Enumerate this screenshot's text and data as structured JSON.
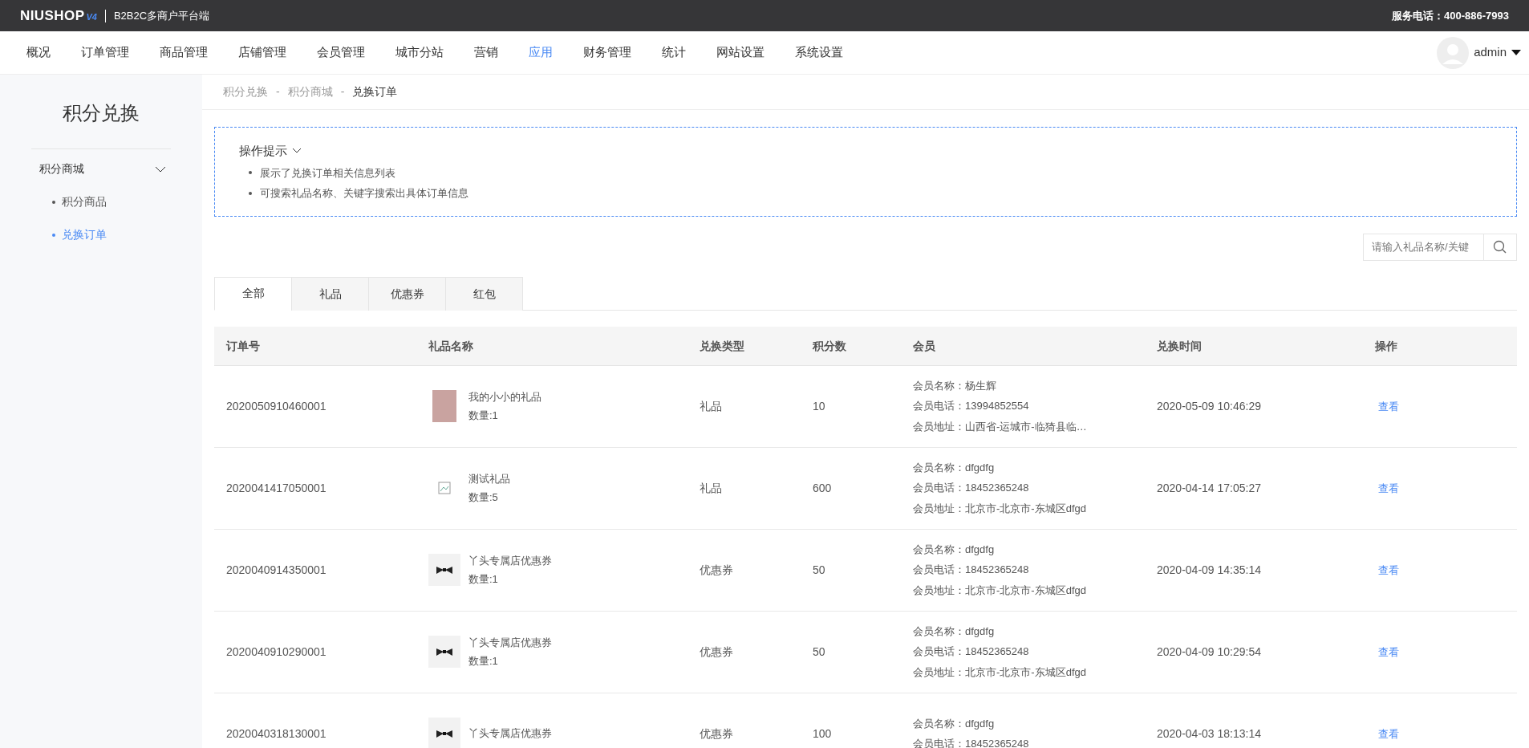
{
  "topbar": {
    "logo": "NIUSHOP",
    "logo_badge": "V4",
    "platform": "B2B2C多商户平台端",
    "service_phone": "服务电话：400-886-7993"
  },
  "nav": [
    {
      "label": "概况",
      "selected": false
    },
    {
      "label": "订单管理",
      "selected": false
    },
    {
      "label": "商品管理",
      "selected": false
    },
    {
      "label": "店铺管理",
      "selected": false
    },
    {
      "label": "会员管理",
      "selected": false
    },
    {
      "label": "城市分站",
      "selected": false
    },
    {
      "label": "营销",
      "selected": false
    },
    {
      "label": "应用",
      "selected": true
    },
    {
      "label": "财务管理",
      "selected": false
    },
    {
      "label": "统计",
      "selected": false
    },
    {
      "label": "网站设置",
      "selected": false
    },
    {
      "label": "系统设置",
      "selected": false
    }
  ],
  "user": {
    "name": "admin"
  },
  "sidebar": {
    "title": "积分兑换",
    "group": {
      "label": "积分商城",
      "expanded": true,
      "items": [
        {
          "label": "积分商品",
          "selected": false
        },
        {
          "label": "兑换订单",
          "selected": true
        }
      ]
    }
  },
  "breadcrumb": [
    "积分兑换",
    "积分商城",
    "兑换订单"
  ],
  "breadcrumb_separator": "-",
  "tips": {
    "title": "操作提示",
    "items": [
      "展示了兑换订单相关信息列表",
      "可搜索礼品名称、关键字搜索出具体订单信息"
    ]
  },
  "search": {
    "placeholder": "请输入礼品名称/关键"
  },
  "tabs": [
    {
      "label": "全部",
      "selected": true
    },
    {
      "label": "礼品",
      "selected": false
    },
    {
      "label": "优惠券",
      "selected": false
    },
    {
      "label": "红包",
      "selected": false
    }
  ],
  "table": {
    "columns": [
      "订单号",
      "礼品名称",
      "兑换类型",
      "积分数",
      "会员",
      "兑换时间",
      "操作"
    ],
    "rows": [
      {
        "order_no": "2020050910460001",
        "kind": "photo",
        "gift": "我的小小的礼品",
        "quantity": "数量:1",
        "type": "礼品",
        "points": "10",
        "member": [
          "会员名称：杨生辉",
          "会员电话：13994852554",
          "会员地址：山西省-运城市-临猗县临…"
        ],
        "time": "2020-05-09 10:46:29",
        "action": "查看"
      },
      {
        "order_no": "2020041417050001",
        "kind": "broken",
        "gift": "测试礼品",
        "quantity": "数量:5",
        "type": "礼品",
        "points": "600",
        "member": [
          "会员名称：dfgdfg",
          "会员电话：18452365248",
          "会员地址：北京市-北京市-东城区dfgd"
        ],
        "time": "2020-04-14 17:05:27",
        "action": "查看"
      },
      {
        "order_no": "2020040914350001",
        "kind": "bowtie",
        "gift": "丫头专属店优惠券",
        "quantity": "数量:1",
        "type": "优惠券",
        "points": "50",
        "member": [
          "会员名称：dfgdfg",
          "会员电话：18452365248",
          "会员地址：北京市-北京市-东城区dfgd"
        ],
        "time": "2020-04-09 14:35:14",
        "action": "查看"
      },
      {
        "order_no": "2020040910290001",
        "kind": "bowtie",
        "gift": "丫头专属店优惠券",
        "quantity": "数量:1",
        "type": "优惠券",
        "points": "50",
        "member": [
          "会员名称：dfgdfg",
          "会员电话：18452365248",
          "会员地址：北京市-北京市-东城区dfgd"
        ],
        "time": "2020-04-09 10:29:54",
        "action": "查看"
      },
      {
        "order_no": "2020040318130001",
        "kind": "bowtie",
        "gift": "丫头专属店优惠券",
        "type": "优惠券",
        "points": "100",
        "member": [
          "会员名称：dfgdfg",
          "会员电话：18452365248"
        ],
        "time": "2020-04-03 18:13:14",
        "action": "查看"
      }
    ]
  }
}
